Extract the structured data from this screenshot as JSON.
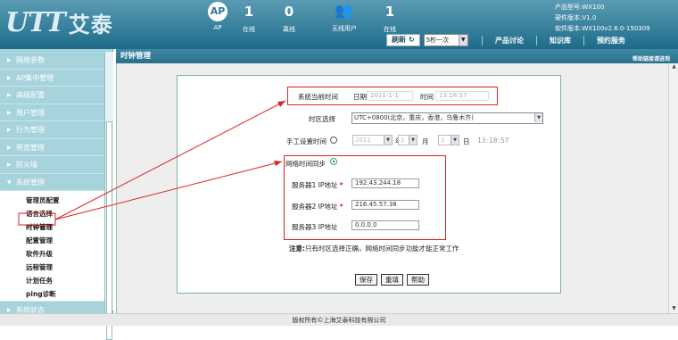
{
  "header": {
    "logo_mark": "UTT",
    "logo_cn": "艾泰",
    "ap_icon": "AP",
    "stats": [
      {
        "value": "1",
        "label": "在线"
      },
      {
        "value": "0",
        "label": "离线"
      },
      {
        "value": "1",
        "label": "在线"
      }
    ],
    "ap_label": "AP",
    "wireless_users_label": "无线用户",
    "product_model": "产品型号:WX100",
    "hardware_version": "硬件版本:V1.0",
    "software_version": "软件版本:WX100v2.6.0-150309",
    "refresh_label": "刷新",
    "refresh_interval": "5秒一次",
    "nav_links": [
      "产品讨论",
      "知识库",
      "预约服务"
    ]
  },
  "sidebar": {
    "items": [
      {
        "label": "网络参数"
      },
      {
        "label": "AP集中管理"
      },
      {
        "label": "高级配置"
      },
      {
        "label": "用户管理"
      },
      {
        "label": "行为管理"
      },
      {
        "label": "带宽管理"
      },
      {
        "label": "防火墙"
      },
      {
        "label": "系统管理"
      },
      {
        "label": "系统状态"
      }
    ],
    "sub_items": [
      "管理员配置",
      "语言选择",
      "时钟管理",
      "配置管理",
      "软件升级",
      "远程管理",
      "计划任务",
      "ping诊断"
    ]
  },
  "main": {
    "title": "时钟管理",
    "help_link": "帮助链接请进到",
    "current_time_label": "系统当前时间",
    "date_label": "日期",
    "date_value": "2011-1-1",
    "time_label": "时间",
    "time_value": "13:18:57",
    "timezone_label": "时区选择",
    "timezone_value": "UTC+0800(北京，重庆，香港，乌鲁木齐)",
    "manual_label": "手工设置时间",
    "manual_year": "2011",
    "year_unit": "年",
    "manual_month": "1",
    "month_unit": "月",
    "manual_day": "1",
    "day_unit": "日",
    "manual_hour": "13",
    "manual_minute": "18",
    "manual_second": "57",
    "ntp_label": "网络时间同步",
    "server1_label": "服务器1 IP地址",
    "server1_value": "192.43.244.18",
    "server2_label": "服务器2 IP地址",
    "server2_value": "216.45.57.38",
    "server3_label": "服务器3 IP地址",
    "server3_value": "0.0.0.0",
    "note_label": "注意:",
    "note_text": "只有时区选择正确，网络时间同步功能才能正常工作",
    "save_label": "保存",
    "reset_label": "重填",
    "help_label": "帮助"
  },
  "footer": {
    "copyright": "版权所有©上海艾泰科技有限公司"
  }
}
